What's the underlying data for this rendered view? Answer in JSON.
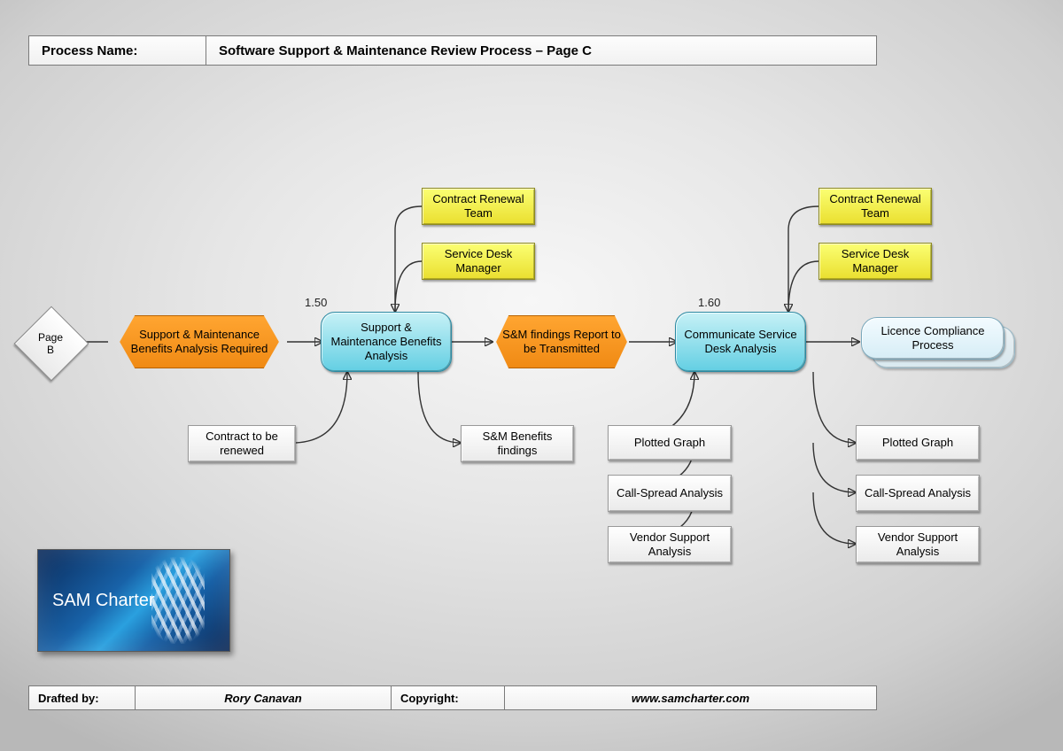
{
  "header": {
    "label": "Process Name:",
    "value": "Software Support & Maintenance Review Process – Page C"
  },
  "footer": {
    "drafted_label": "Drafted by:",
    "drafted_value": "Rory Canavan",
    "copyright_label": "Copyright:",
    "copyright_value": "www.samcharter.com"
  },
  "logo_text": "SAM Charter",
  "nodes": {
    "page_b": "Page\nB",
    "hex_1": "Support & Maintenance Benefits Analysis Required",
    "step_150_id": "1.50",
    "step_150_label": "Support & Maintenance Benefits Analysis",
    "hex_2": "S&M findings Report to be Transmitted",
    "step_160_id": "1.60",
    "step_160_label": "Communicate Service Desk Analysis",
    "end_label": "Licence Compliance Process",
    "actors_left": [
      "Contract Renewal Team",
      "Service Desk Manager"
    ],
    "actors_right": [
      "Contract Renewal Team",
      "Service Desk Manager"
    ],
    "input_150": "Contract to be renewed",
    "output_150": "S&M Benefits findings",
    "inputs_160": [
      "Plotted Graph",
      "Call-Spread Analysis",
      "Vendor Support Analysis"
    ],
    "outputs_160": [
      "Plotted Graph",
      "Call-Spread Analysis",
      "Vendor Support Analysis"
    ]
  }
}
